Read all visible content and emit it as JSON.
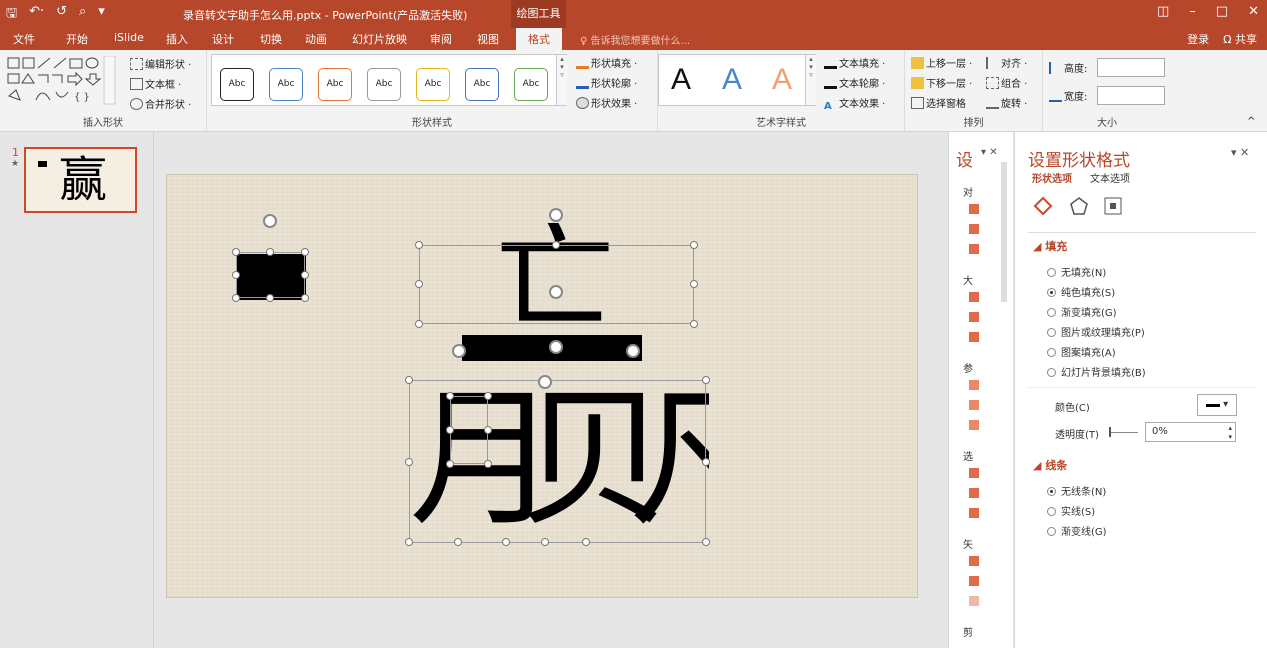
{
  "window": {
    "title": "录音转文字助手怎么用.pptx - PowerPoint(产品激活失败)",
    "context_tab": "绘图工具",
    "controls": [
      "◫",
      "–",
      "□",
      "✕"
    ]
  },
  "qat": [
    "🖫",
    "↶·",
    "↺",
    "⌕",
    "▾"
  ],
  "tabs": [
    "文件",
    "开始",
    "iSlide",
    "插入",
    "设计",
    "切换",
    "动画",
    "幻灯片放映",
    "审阅",
    "视图",
    "格式"
  ],
  "active_tab": "格式",
  "tellme": "♀ 告诉我您想要做什么...",
  "account": {
    "login": "登录",
    "share": "Ω 共享"
  },
  "ribbon": {
    "insert_shapes": {
      "label": "插入形状",
      "edit_shape": "编辑形状 ·",
      "text_box": "文本框 ·",
      "merge_shapes": "合并形状 ·"
    },
    "shape_styles": {
      "label": "形状样式",
      "swatches": [
        {
          "text": "Abc",
          "color": "#222222"
        },
        {
          "text": "Abc",
          "color": "#4a86c8"
        },
        {
          "text": "Abc",
          "color": "#e07b40"
        },
        {
          "text": "Abc",
          "color": "#999999"
        },
        {
          "text": "Abc",
          "color": "#e8b520"
        },
        {
          "text": "Abc",
          "color": "#4a72b8"
        },
        {
          "text": "Abc",
          "color": "#6aa84f"
        }
      ],
      "fill": "形状填充 ·",
      "outline": "形状轮廓 ·",
      "effects": "形状效果 ·"
    },
    "wordart": {
      "label": "艺术字样式",
      "letters": [
        {
          "text": "A",
          "color": "#111111"
        },
        {
          "text": "A",
          "color": "#4a86c8"
        },
        {
          "text": "A",
          "color": "#f0a070"
        }
      ],
      "text_fill": "文本填充 ·",
      "text_outline": "文本轮廓 ·",
      "text_effects": "文本效果 ·"
    },
    "arrange": {
      "label": "排列",
      "bring_forward": "上移一层 ·",
      "send_backward": "下移一层 ·",
      "selection_pane": "选择窗格",
      "align": "对齐 ·",
      "group": "组合 ·",
      "rotate": "旋转 ·"
    },
    "size": {
      "label": "大小",
      "height": "高度:",
      "width": "宽度:",
      "height_value": "",
      "width_value": ""
    }
  },
  "slide_number": "1",
  "slide_star": "★",
  "thumb_glyph": "赢",
  "slide_glyph_top": "亡",
  "slide_glyph_bottom": "月贝凡",
  "selection_pane": {
    "title": "设",
    "sections": [
      "对",
      "大",
      "参",
      "选",
      "矢",
      "剪"
    ]
  },
  "format_pane": {
    "title": "设置形状格式",
    "tab_shape": "形状选项",
    "tab_text": "文本选项",
    "fill_section": "填充",
    "fill_options": [
      {
        "label": "无填充(N)",
        "checked": false
      },
      {
        "label": "纯色填充(S)",
        "checked": true
      },
      {
        "label": "渐变填充(G)",
        "checked": false
      },
      {
        "label": "图片或纹理填充(P)",
        "checked": false
      },
      {
        "label": "图案填充(A)",
        "checked": false
      },
      {
        "label": "幻灯片背景填充(B)",
        "checked": false
      }
    ],
    "color_label": "颜色(C)",
    "transparency_label": "透明度(T)",
    "transparency_value": "0%",
    "line_section": "线条",
    "line_options": [
      {
        "label": "无线条(N)",
        "checked": true
      },
      {
        "label": "实线(S)",
        "checked": false
      },
      {
        "label": "渐变线(G)",
        "checked": false
      }
    ]
  },
  "colors": {
    "accent": "#b7472a",
    "slide_bg": "#e9e1d2",
    "thumb_border": "#d24726"
  }
}
